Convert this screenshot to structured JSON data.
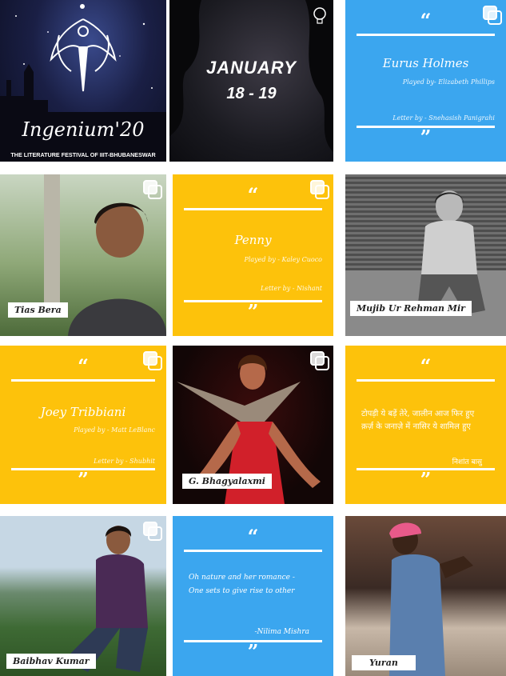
{
  "colors": {
    "blue": "#3ba6ef",
    "yellow": "#fdc20b",
    "white": "#ffffff"
  },
  "poster": {
    "title": "Ingenium'20",
    "tagline": "THE LITERATURE FESTIVAL OF IIIT-BHUBANESWAR",
    "icon": "quill-phoenix-logo"
  },
  "dates": {
    "month": "JANUARY",
    "days": "18 - 19",
    "icon": "lightbulb-logo"
  },
  "open_quote": "“",
  "close_quote": "”",
  "cards": {
    "eurus": {
      "name": "Eurus Holmes",
      "played_by": "Played by- Elizabeth Phillips",
      "letter_by": "Letter by - Snehasish Panigrahi"
    },
    "penny": {
      "name": "Penny",
      "played_by": "Played by - Kaley Cuoco",
      "letter_by": "Letter by - Nishant"
    },
    "joey": {
      "name": "Joey Tribbiani",
      "played_by": "Played by - Matt LeBlanc",
      "letter_by": "Letter by - Shubhit"
    },
    "hindi": {
      "line1": "टोपड़ी ये बड़ें तेरे, जालीन आज फिर हुए",
      "line2": "क़र्ज़ के जनाज़े में नासिर ये शामिल हुए",
      "sign": "निशांत बासु"
    },
    "nature": {
      "line1": "Oh nature and her romance -",
      "line2": "One sets to give rise to other",
      "sign": "-Nilima Mishra"
    }
  },
  "photos": {
    "tias": "Tias Bera",
    "mujib": "Mujib Ur Rehman Mir",
    "bhagyalaxmi": "G. Bhagyalaxmi",
    "baibhav": "Baibhav Kumar",
    "yuran": "Yuran"
  }
}
